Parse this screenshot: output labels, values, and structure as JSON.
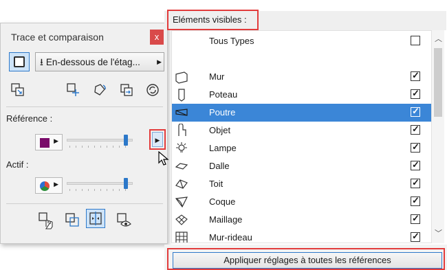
{
  "palette": {
    "title": "Trace et comparaison",
    "close_label": "x",
    "floor_button_label": "En-dessous de l'étag...",
    "reference_label": "Référence :",
    "active_label": "Actif :",
    "reference_slider_fraction": 0.95,
    "active_slider_fraction": 0.95,
    "reference_color": "#7a0a6a"
  },
  "visible_elements": {
    "header": "Eléments visibles :",
    "rows": [
      {
        "label": "Tous Types",
        "checked": false,
        "icon": "none"
      },
      {
        "label": "",
        "checked": null,
        "icon": "none"
      },
      {
        "label": "Mur",
        "checked": true,
        "icon": "wall-icon"
      },
      {
        "label": "Poteau",
        "checked": true,
        "icon": "column-icon"
      },
      {
        "label": "Poutre",
        "checked": true,
        "icon": "beam-icon",
        "selected": true
      },
      {
        "label": "Objet",
        "checked": true,
        "icon": "object-icon"
      },
      {
        "label": "Lampe",
        "checked": true,
        "icon": "lamp-icon"
      },
      {
        "label": "Dalle",
        "checked": true,
        "icon": "slab-icon"
      },
      {
        "label": "Toit",
        "checked": true,
        "icon": "roof-icon"
      },
      {
        "label": "Coque",
        "checked": true,
        "icon": "shell-icon"
      },
      {
        "label": "Maillage",
        "checked": true,
        "icon": "mesh-icon"
      },
      {
        "label": "Mur-rideau",
        "checked": true,
        "icon": "curtain-wall-icon"
      }
    ],
    "apply_label": "Appliquer réglages à toutes les références"
  },
  "colors": {
    "accent": "#2c78c9",
    "selection": "#3b86d7",
    "highlight_frame": "#e23b3b"
  }
}
